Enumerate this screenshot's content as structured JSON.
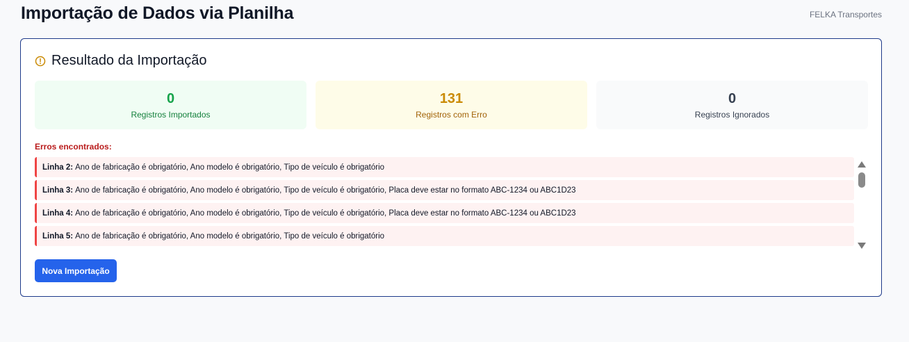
{
  "header": {
    "title": "Importação de Dados via Planilha",
    "company": "FELKA Transportes"
  },
  "result": {
    "title": "Resultado da Importação",
    "icon": "warning-circle-icon",
    "accent_color": "#ca8a04"
  },
  "stats": [
    {
      "value": "0",
      "label": "Registros Importados",
      "color": "#16a34a"
    },
    {
      "value": "131",
      "label": "Registros com Erro",
      "color": "#ca8a04"
    },
    {
      "value": "0",
      "label": "Registros Ignorados",
      "color": "#374151"
    }
  ],
  "errors": {
    "title": "Erros encontrados:",
    "items": [
      {
        "line": "Linha 2:",
        "message": "Ano de fabricação é obrigatório, Ano modelo é obrigatório, Tipo de veículo é obrigatório"
      },
      {
        "line": "Linha 3:",
        "message": "Ano de fabricação é obrigatório, Ano modelo é obrigatório, Tipo de veículo é obrigatório, Placa deve estar no formato ABC-1234 ou ABC1D23"
      },
      {
        "line": "Linha 4:",
        "message": "Ano de fabricação é obrigatório, Ano modelo é obrigatório, Tipo de veículo é obrigatório, Placa deve estar no formato ABC-1234 ou ABC1D23"
      },
      {
        "line": "Linha 5:",
        "message": "Ano de fabricação é obrigatório, Ano modelo é obrigatório, Tipo de veículo é obrigatório"
      }
    ]
  },
  "actions": {
    "new_import_label": "Nova Importação",
    "button_color": "#2563eb"
  }
}
